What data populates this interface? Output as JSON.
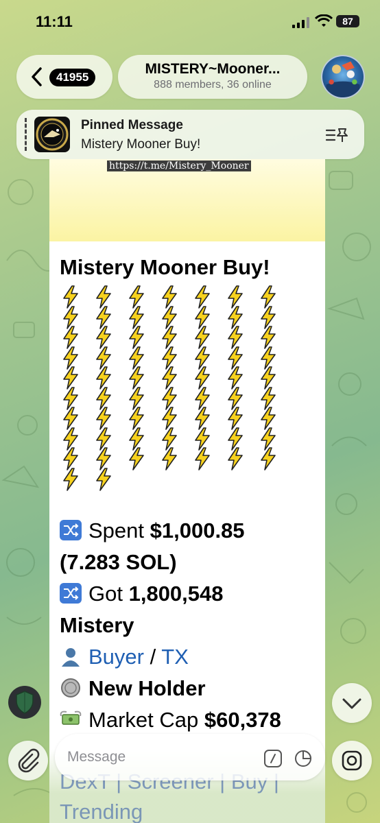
{
  "status_bar": {
    "time": "11:11",
    "battery": "87"
  },
  "header": {
    "back_count": "41955",
    "title": "MISTERY~Mooner...",
    "subtitle": "888 members, 36 online",
    "avatar_icon": "group-avatar"
  },
  "pinned": {
    "label": "Pinned Message",
    "text": "Mistery Mooner Buy!"
  },
  "message": {
    "link_caption": "https://t.me/Mistery_Mooner",
    "title": "Mistery Mooner Buy!",
    "bolt_icon": "lightning-emoji",
    "bolt_columns": [
      10,
      10,
      9,
      9,
      9,
      9,
      9
    ],
    "bolt_extra_row": 2,
    "spent_label": "Spent",
    "spent_value": "$1,000.85",
    "spent_sol": "(7.283 SOL)",
    "got_label": "Got",
    "got_value": "1,800,548",
    "token": "Mistery",
    "buyer_link": "Buyer",
    "separator": "/",
    "tx_link": "TX",
    "new_holder": "New Holder",
    "market_cap_label": "Market Cap",
    "market_cap_value": "$60,378",
    "links_line": "DexT | Screener | Buy |",
    "links_line2": "Trending"
  },
  "composer": {
    "placeholder": "Message"
  },
  "colors": {
    "link": "#1f5fb3",
    "bolt": "#f7d21e"
  }
}
